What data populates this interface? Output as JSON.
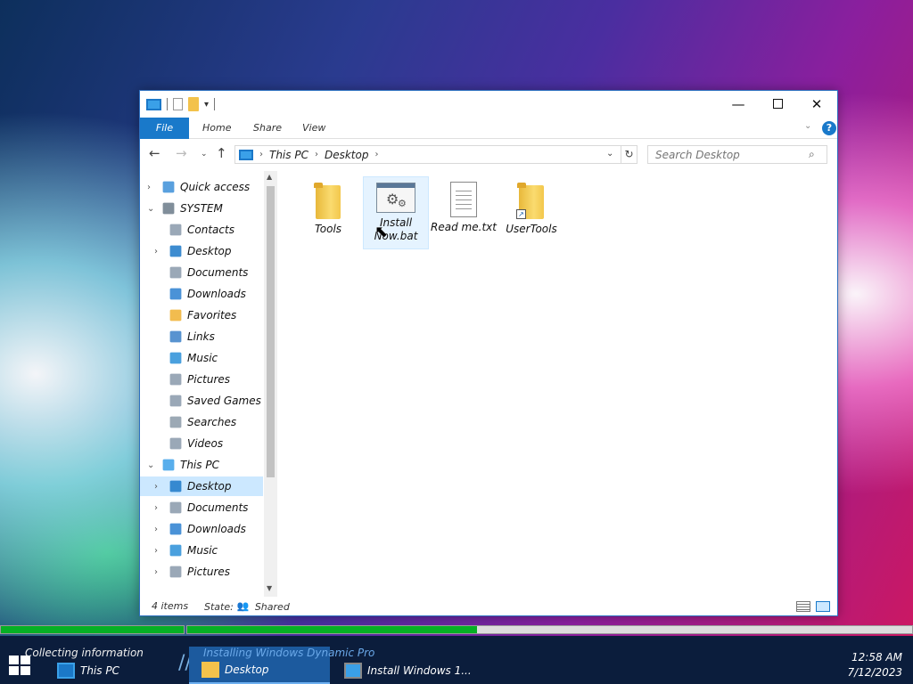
{
  "window": {
    "ribbon_tabs": [
      "File",
      "Home",
      "Share",
      "View"
    ],
    "help_label": "?"
  },
  "address": {
    "crumbs": [
      "This PC",
      "Desktop"
    ],
    "search_placeholder": "Search Desktop"
  },
  "nav_pane": {
    "items": [
      {
        "label": "Quick access",
        "icon": "star-icon",
        "level": 0,
        "expander": "›"
      },
      {
        "label": "SYSTEM",
        "icon": "user-icon",
        "level": 0,
        "expander": "⌄"
      },
      {
        "label": "Contacts",
        "icon": "contacts-icon",
        "level": 1,
        "expander": ""
      },
      {
        "label": "Desktop",
        "icon": "desktop-icon",
        "level": 1,
        "expander": "›"
      },
      {
        "label": "Documents",
        "icon": "documents-icon",
        "level": 1,
        "expander": ""
      },
      {
        "label": "Downloads",
        "icon": "downloads-icon",
        "level": 1,
        "expander": ""
      },
      {
        "label": "Favorites",
        "icon": "favorites-icon",
        "level": 1,
        "expander": ""
      },
      {
        "label": "Links",
        "icon": "links-icon",
        "level": 1,
        "expander": ""
      },
      {
        "label": "Music",
        "icon": "music-icon",
        "level": 1,
        "expander": ""
      },
      {
        "label": "Pictures",
        "icon": "pictures-icon",
        "level": 1,
        "expander": ""
      },
      {
        "label": "Saved Games",
        "icon": "saved-games-icon",
        "level": 1,
        "expander": ""
      },
      {
        "label": "Searches",
        "icon": "searches-icon",
        "level": 1,
        "expander": ""
      },
      {
        "label": "Videos",
        "icon": "videos-icon",
        "level": 1,
        "expander": ""
      },
      {
        "label": "This PC",
        "icon": "this-pc-icon",
        "level": 0,
        "expander": "⌄"
      },
      {
        "label": "Desktop",
        "icon": "desktop-icon",
        "level": 1,
        "expander": "›",
        "selected": true
      },
      {
        "label": "Documents",
        "icon": "documents-icon",
        "level": 1,
        "expander": "›"
      },
      {
        "label": "Downloads",
        "icon": "downloads-icon",
        "level": 1,
        "expander": "›"
      },
      {
        "label": "Music",
        "icon": "music-icon",
        "level": 1,
        "expander": "›"
      },
      {
        "label": "Pictures",
        "icon": "pictures-icon",
        "level": 1,
        "expander": "›"
      }
    ]
  },
  "files": [
    {
      "label": "Tools",
      "type": "folder"
    },
    {
      "label": "Install Now.bat",
      "type": "batch",
      "selected": true
    },
    {
      "label": "Read me.txt",
      "type": "text"
    },
    {
      "label": "UserTools",
      "type": "folder-shortcut"
    }
  ],
  "status": {
    "count": "4 items",
    "state_label": "State:",
    "state_value": "Shared"
  },
  "progress": {
    "bar1": 1.0,
    "bar2": 0.4,
    "color": "#06b025"
  },
  "taskbar": {
    "items": [
      {
        "label": "This PC",
        "overlay": "Collecting information",
        "active": false
      },
      {
        "label": "Desktop",
        "overlay": "Installing Windows Dynamic Pro",
        "active": true
      },
      {
        "label": "Install Windows 1...",
        "overlay": "",
        "active": false
      }
    ],
    "clock_time": "12:58 AM",
    "clock_date": "7/12/2023"
  }
}
